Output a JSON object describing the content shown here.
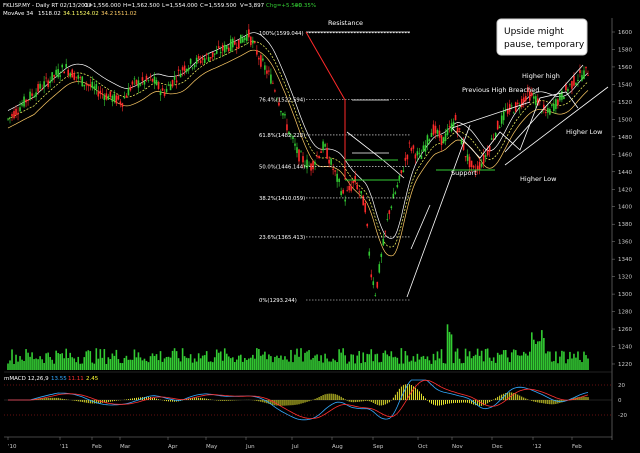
{
  "header": {
    "symbol_line": "FKLISP.MY - Daily RT  02/13/2012",
    "open": "O=1,556.000",
    "high": "H=1,562.500",
    "low": "L=1,554.000",
    "close": "C=1,559.500",
    "volume": "V=3,897",
    "change": "Chg=+5.500",
    "change_pct": "+0.35%",
    "ma_label": "MovAve 34",
    "ma_values": [
      "1518.02",
      "34.1",
      "1524.02",
      "34.2",
      "1511.02"
    ]
  },
  "macd_header": {
    "label": "mMACD 12,26,9",
    "v1": "13.55",
    "v2": "11.11",
    "v3": "2.45"
  },
  "annotations": {
    "resistance": "Resistance",
    "support": "Support",
    "previous_high": "Previous High Breached",
    "higher_high": "Higher high",
    "higher_low_1": "Higher Low",
    "higher_low_2": "Higher Low",
    "callout": "Upside might pause, temporary"
  },
  "fib_levels": [
    {
      "label": "100%(1599.044)",
      "price": 1599.044,
      "color": "#ffffff"
    },
    {
      "label": "76.4%(1522.594)",
      "price": 1522.594,
      "color": "#ffffff"
    },
    {
      "label": "61.8%(1482.228)",
      "price": 1482.228,
      "color": "#ffffff"
    },
    {
      "label": "50.0%(1446.144)",
      "price": 1446.144,
      "color": "#ffffff"
    },
    {
      "label": "38.2%(1410.059)",
      "price": 1410.059,
      "color": "#ffffff"
    },
    {
      "label": "23.6%(1365.413)",
      "price": 1365.413,
      "color": "#ffffff"
    },
    {
      "label": "0%(1293.244)",
      "price": 1293.244,
      "color": "#ffffff"
    }
  ],
  "price_axis": {
    "min": 1180,
    "max": 1620,
    "ticks": [
      "1600",
      "1580",
      "1560",
      "1540",
      "1520",
      "1500",
      "1480",
      "1460",
      "1440",
      "1420",
      "1400",
      "1380",
      "1360",
      "1340",
      "1320",
      "1300",
      "1280",
      "1260",
      "1240",
      "1220"
    ]
  },
  "macd_axis": {
    "ticks": [
      "20",
      "0",
      "-20"
    ]
  },
  "time_axis": [
    "'10",
    "'11",
    "Feb",
    "Mar",
    "Apr",
    "May",
    "Jun",
    "Jul",
    "Aug",
    "Sep",
    "Oct",
    "Nov",
    "Dec",
    "'12",
    "Feb"
  ],
  "colors": {
    "up": "#33cc33",
    "down": "#ff2a2a",
    "volume": "#33cc33",
    "ma_fast": "#ffffff",
    "ma_dash": "#ffff66",
    "ma_slow": "#ffcc66",
    "trend": "#ffffff",
    "support": "#33cc33",
    "macd": "#33aaff",
    "signal": "#ff3030",
    "hist": "#ffff33",
    "grid_dot": "#cc2222"
  }
}
